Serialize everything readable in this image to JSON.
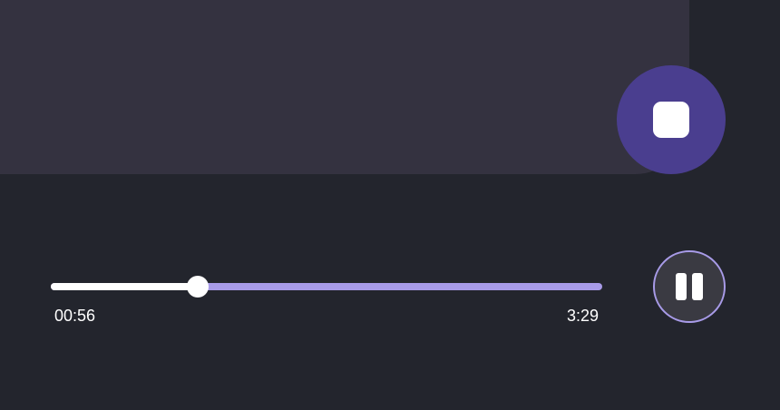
{
  "player": {
    "elapsed": "00:56",
    "total": "3:29",
    "progress": 0.267
  },
  "icons": {
    "stop": "stop-icon",
    "pause": "pause-icon"
  },
  "colors": {
    "background": "#23252d",
    "panel": "#343240",
    "accent": "#4a3e8f",
    "track": "#a89be8",
    "fill": "#ffffff"
  }
}
